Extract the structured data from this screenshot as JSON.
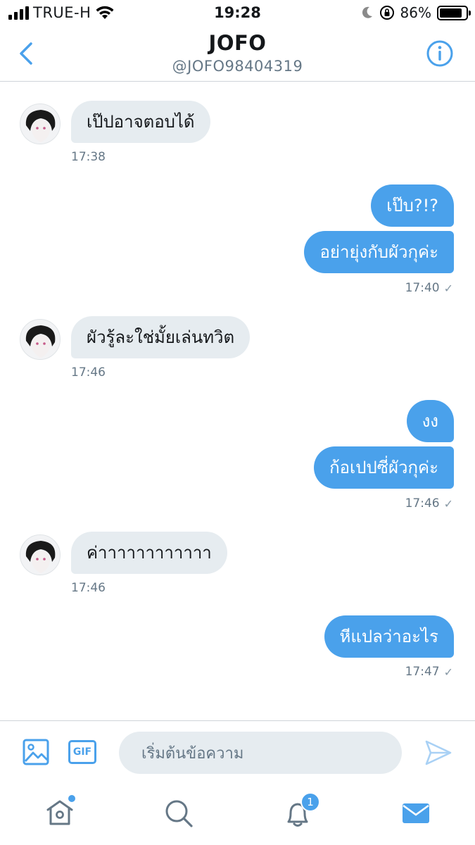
{
  "status_bar": {
    "carrier": "TRUE-H",
    "time": "19:28",
    "battery": "86%",
    "battery_level": 0.86
  },
  "header": {
    "title": "JOFO",
    "handle": "@JOFO98404319",
    "back_icon": "chevron-left-icon",
    "info_icon": "info-icon"
  },
  "messages": [
    {
      "side": "in",
      "text": "เป๊ปอาจตอบได้",
      "time": "17:38"
    },
    {
      "side": "out",
      "text": "เป๊บ?!?"
    },
    {
      "side": "out",
      "text": "อย่ายุ่งกับผัวกุค่ะ",
      "time": "17:40"
    },
    {
      "side": "in",
      "text": "ผัวรู้ละใช่มั้ยเล่นทวิต",
      "time": "17:46"
    },
    {
      "side": "out",
      "text": "งง"
    },
    {
      "side": "out",
      "text": "ก้อเปปซี่ผัวกุค่ะ",
      "time": "17:46"
    },
    {
      "side": "in",
      "text": "ค่าาาาาาาาาาาา",
      "time": "17:46"
    },
    {
      "side": "out",
      "text": "หีแปลว่าอะไร",
      "time": "17:47"
    }
  ],
  "composer": {
    "gif_label": "GIF",
    "placeholder": "เริ่มต้นข้อความ"
  },
  "tabbar": {
    "notifications_badge": "1"
  },
  "colors": {
    "accent": "#4aa1eb",
    "incoming_bubble": "#e6ecf0",
    "muted_text": "#657786"
  }
}
